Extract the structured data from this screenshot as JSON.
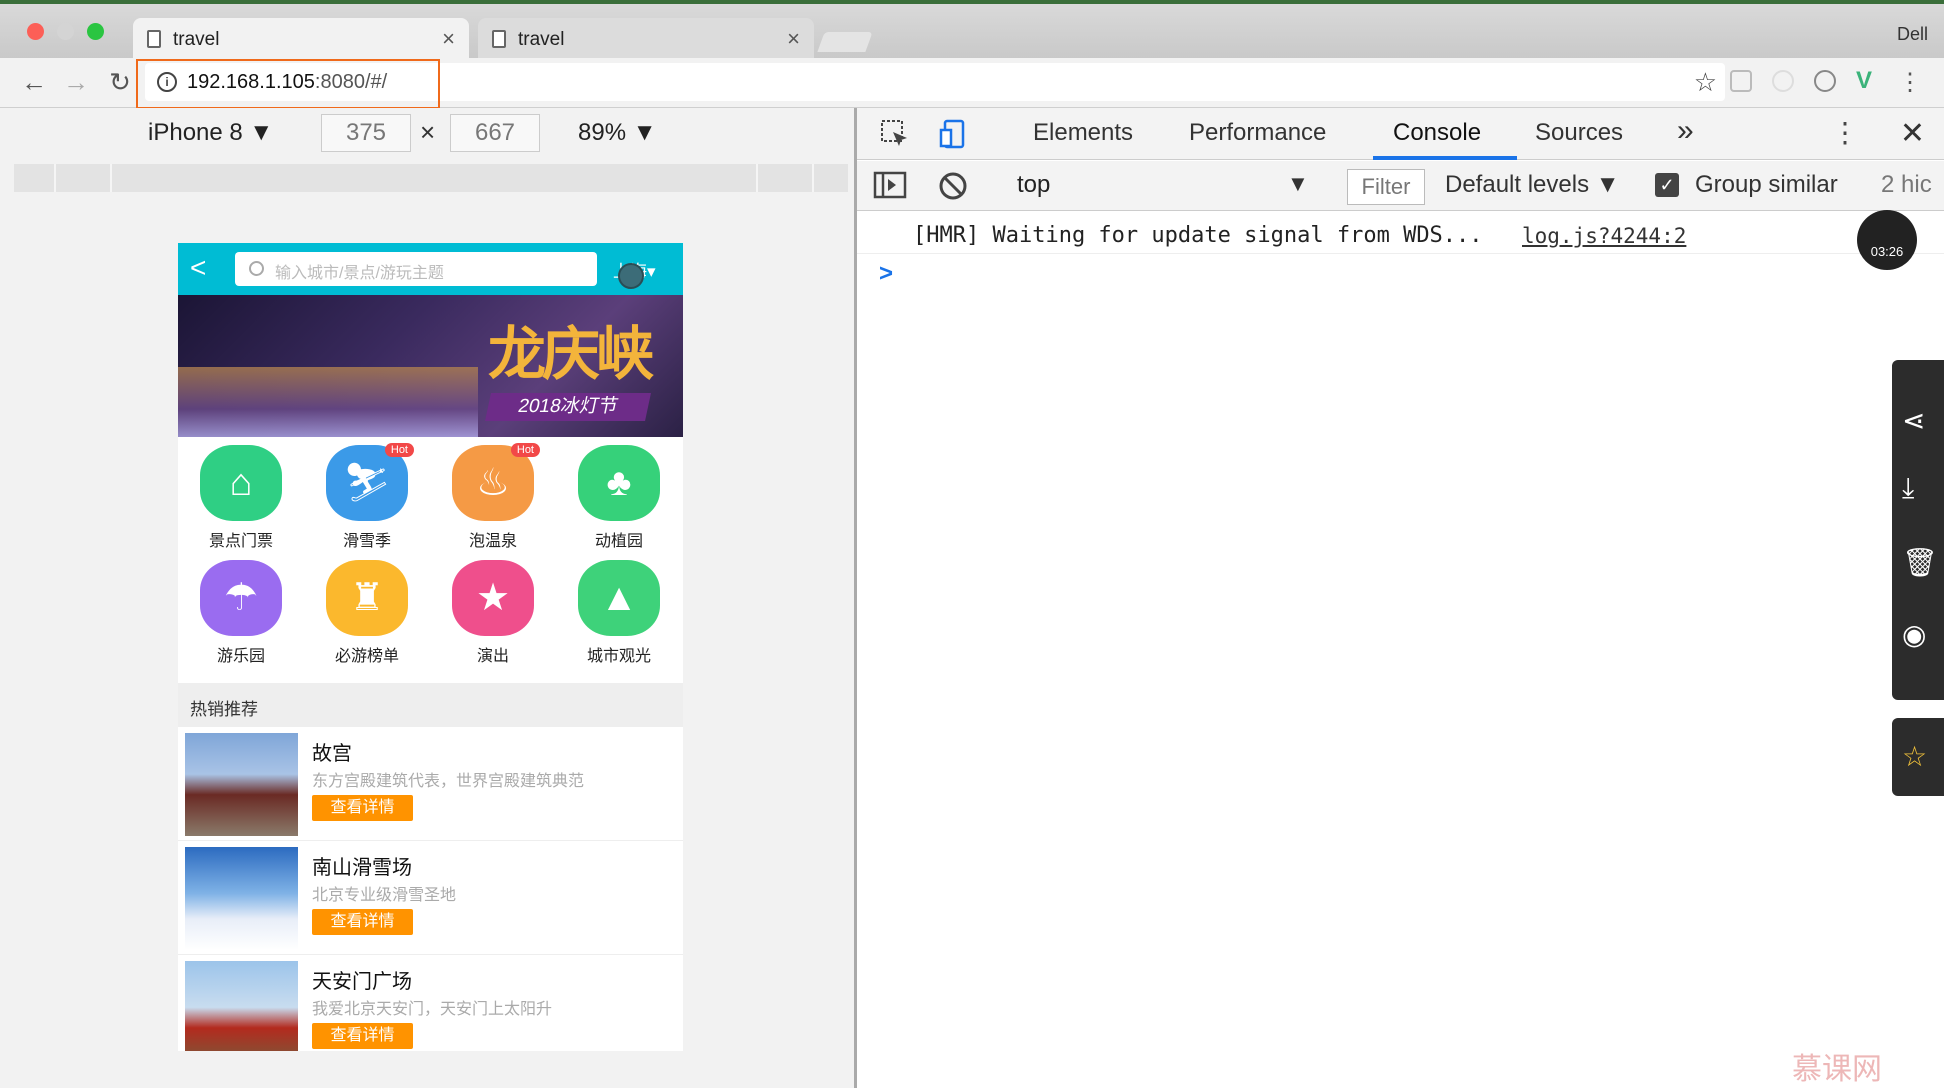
{
  "browser": {
    "tabs": [
      {
        "title": "travel",
        "close": "×"
      },
      {
        "title": "travel",
        "close": "×"
      }
    ],
    "profile": "Dell",
    "url_host": "192.168.1.105",
    "url_rest": ":8080/#/",
    "back_icon": "←",
    "forward_icon": "→",
    "reload_icon": "↻",
    "star_icon": "☆"
  },
  "device_toolbar": {
    "device": "iPhone 8 ▼",
    "width": "375",
    "height": "667",
    "times": "×",
    "zoom": "89% ▼"
  },
  "phone": {
    "back": "<",
    "search_placeholder": "输入城市/景点/游玩主题",
    "city": "上海▾",
    "banner_brand": "龙庆峡",
    "banner_sub": "2018冰灯节",
    "icons": [
      {
        "label": "景点门票",
        "glyph": "⌂",
        "color": "#2fcf84",
        "hot": ""
      },
      {
        "label": "滑雪季",
        "glyph": "⛷",
        "color": "#3b9ae8",
        "hot": "Hot"
      },
      {
        "label": "泡温泉",
        "glyph": "♨",
        "color": "#f59a45",
        "hot": "Hot"
      },
      {
        "label": "动植园",
        "glyph": "♣",
        "color": "#36d17a",
        "hot": ""
      },
      {
        "label": "游乐园",
        "glyph": "☂",
        "color": "#9a6cf0",
        "hot": ""
      },
      {
        "label": "必游榜单",
        "glyph": "♜",
        "color": "#fbb82d",
        "hot": ""
      },
      {
        "label": "演出",
        "glyph": "★",
        "color": "#ef4f8c",
        "hot": ""
      },
      {
        "label": "城市观光",
        "glyph": "▲",
        "color": "#3ed27a",
        "hot": ""
      }
    ],
    "section_title": "热销推荐",
    "recommendations": [
      {
        "title": "故宫",
        "desc": "东方宫殿建筑代表，世界宫殿建筑典范",
        "button": "查看详情"
      },
      {
        "title": "南山滑雪场",
        "desc": "北京专业级滑雪圣地",
        "button": "查看详情"
      },
      {
        "title": "天安门广场",
        "desc": "我爱北京天安门，天安门上太阳升",
        "button": "查看详情"
      }
    ]
  },
  "devtools": {
    "tabs": [
      "Elements",
      "Performance",
      "Console",
      "Sources"
    ],
    "active_tab": "Console",
    "overflow": "»",
    "more": "⋮",
    "close": "✕",
    "context": "top",
    "filter": "Filter",
    "levels": "Default levels ▼",
    "group_similar": "Group similar",
    "hidden": "2 hic",
    "console_message": "[HMR] Waiting for update signal from WDS...",
    "console_source": "log.js?4244:2",
    "prompt": ">",
    "timer": "03:26"
  },
  "watermark": "慕课网"
}
